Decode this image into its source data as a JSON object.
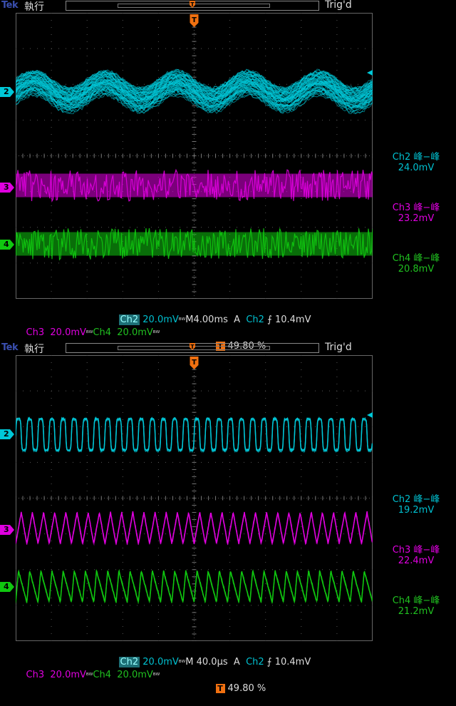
{
  "screens": [
    {
      "brand": "Tek",
      "run_state": "執行",
      "trig_state": "Trig'd",
      "channels": [
        {
          "id": "2",
          "color": "#00c8d8",
          "shape": "sine",
          "cycles": 5
        },
        {
          "id": "3",
          "color": "#e000e0",
          "shape": "noise"
        },
        {
          "id": "4",
          "color": "#10c810",
          "shape": "noise"
        }
      ],
      "measurements": [
        {
          "label": "Ch2 峰−峰",
          "value": "24.0mV",
          "color": "#00c0d0"
        },
        {
          "label": "Ch3 峰−峰",
          "value": "23.2mV",
          "color": "#e000e0"
        },
        {
          "label": "Ch4 峰−峰",
          "value": "20.8mV",
          "color": "#20c020"
        }
      ],
      "status": {
        "ch2_label": "Ch2",
        "ch2_scale": "20.0mV",
        "ch3_label": "Ch3",
        "ch3_scale": "20.0mV",
        "ch4_label": "Ch4",
        "ch4_scale": "20.0mV",
        "bw_glyph": "ᴮᵂ",
        "timebase": "M4.00ms",
        "trig_mode": "A",
        "trig_source": "Ch2",
        "trig_slope": "⨍",
        "trig_level": "10.4mV",
        "trig_badge": "T",
        "trig_pos": "49.80 %"
      }
    },
    {
      "brand": "Tek",
      "run_state": "執行",
      "trig_state": "Trig'd",
      "channels": [
        {
          "id": "2",
          "color": "#00c8d8",
          "shape": "square",
          "cycles": 32
        },
        {
          "id": "3",
          "color": "#e000e0",
          "shape": "tri",
          "cycles": 32
        },
        {
          "id": "4",
          "color": "#10c810",
          "shape": "saw",
          "cycles": 32
        }
      ],
      "measurements": [
        {
          "label": "Ch2 峰−峰",
          "value": "19.2mV",
          "color": "#00c0d0"
        },
        {
          "label": "Ch3 峰−峰",
          "value": "22.4mV",
          "color": "#e000e0"
        },
        {
          "label": "Ch4 峰−峰",
          "value": "21.2mV",
          "color": "#20c020"
        }
      ],
      "status": {
        "ch2_label": "Ch2",
        "ch2_scale": "20.0mV",
        "ch3_label": "Ch3",
        "ch3_scale": "20.0mV",
        "ch4_label": "Ch4",
        "ch4_scale": "20.0mV",
        "bw_glyph": "ᴮᵂ",
        "timebase": "M 40.0µs",
        "trig_mode": "A",
        "trig_source": "Ch2",
        "trig_slope": "⨍",
        "trig_level": "10.4mV",
        "trig_badge": "T",
        "trig_pos": "49.80 %"
      }
    }
  ]
}
